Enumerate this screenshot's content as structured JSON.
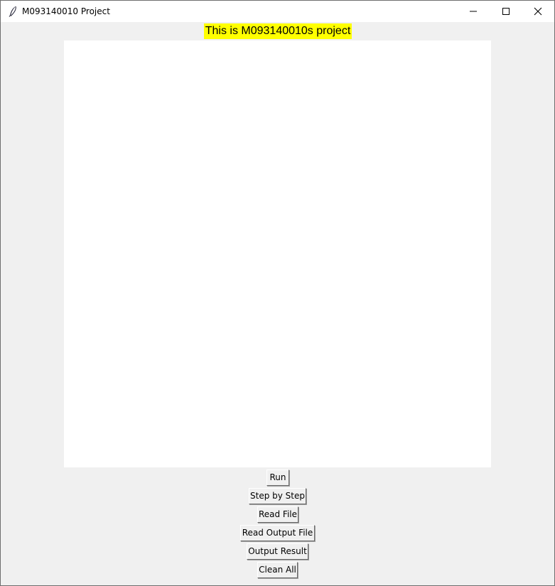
{
  "window": {
    "title": "M093140010 Project",
    "app_icon": "feather-icon",
    "controls": {
      "minimize_icon": "minimize-icon",
      "maximize_icon": "maximize-icon",
      "close_icon": "close-icon"
    }
  },
  "main": {
    "heading": "This is M093140010s project",
    "heading_background": "#ffff00",
    "canvas_background": "#ffffff"
  },
  "buttons": {
    "run": "Run",
    "step_by_step": "Step by Step",
    "read_file": "Read File",
    "read_output_file": "Read Output File",
    "output_result": "Output Result",
    "clean_all": "Clean All"
  }
}
